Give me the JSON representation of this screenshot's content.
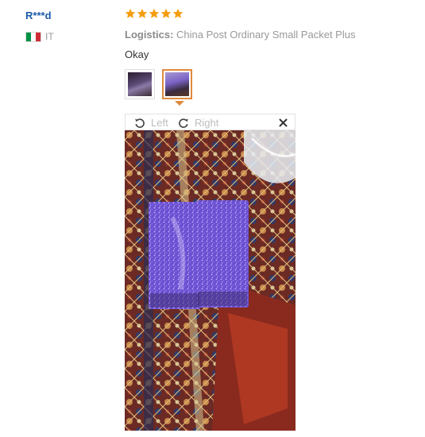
{
  "reviewer": {
    "name": "R***d",
    "country_code": "IT",
    "flag_colors": [
      "#009246",
      "#ffffff",
      "#ce2b37"
    ]
  },
  "rating": {
    "stars": 5,
    "max": 5,
    "color": "#f59d12"
  },
  "logistics": {
    "label": "Logistics:",
    "value": "China Post Ordinary Small Packet Plus"
  },
  "review": {
    "text": "Okay"
  },
  "gallery": {
    "thumbnails": [
      {
        "id": "photo-1",
        "selected": false
      },
      {
        "id": "photo-2",
        "selected": true
      }
    ],
    "selected_border_color": "#e08a3c"
  },
  "viewer": {
    "rotate_left_label": "Left",
    "rotate_right_label": "Right",
    "photo_description": "Two purple glitter pumice stones on a patterned red and blue rug"
  }
}
